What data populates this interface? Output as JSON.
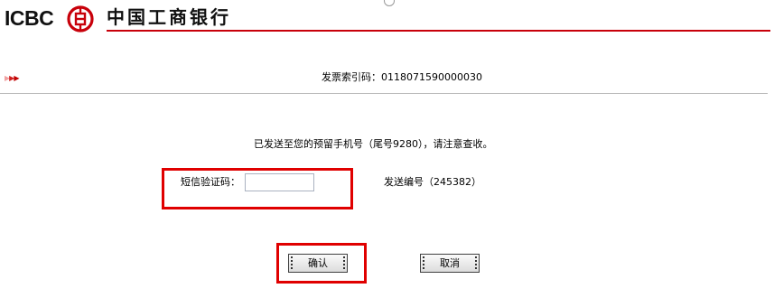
{
  "header": {
    "logo_text": "ICBC",
    "logo_mark_glyph": "工",
    "bank_name": "中国工商银行"
  },
  "info_bar": {
    "invoice_label": "发票索引码：",
    "invoice_code": "0118071590000030"
  },
  "message": {
    "sent_notice": "已发送至您的预留手机号（尾号9280），请注意查收。"
  },
  "form": {
    "sms_label": "短信验证码：",
    "sms_value": "",
    "send_number_label": "发送编号",
    "send_number": "（245382）"
  },
  "buttons": {
    "confirm": "确认",
    "cancel": "取消"
  },
  "colors": {
    "brand_red": "#c8000a",
    "highlight_red": "#e00000"
  }
}
